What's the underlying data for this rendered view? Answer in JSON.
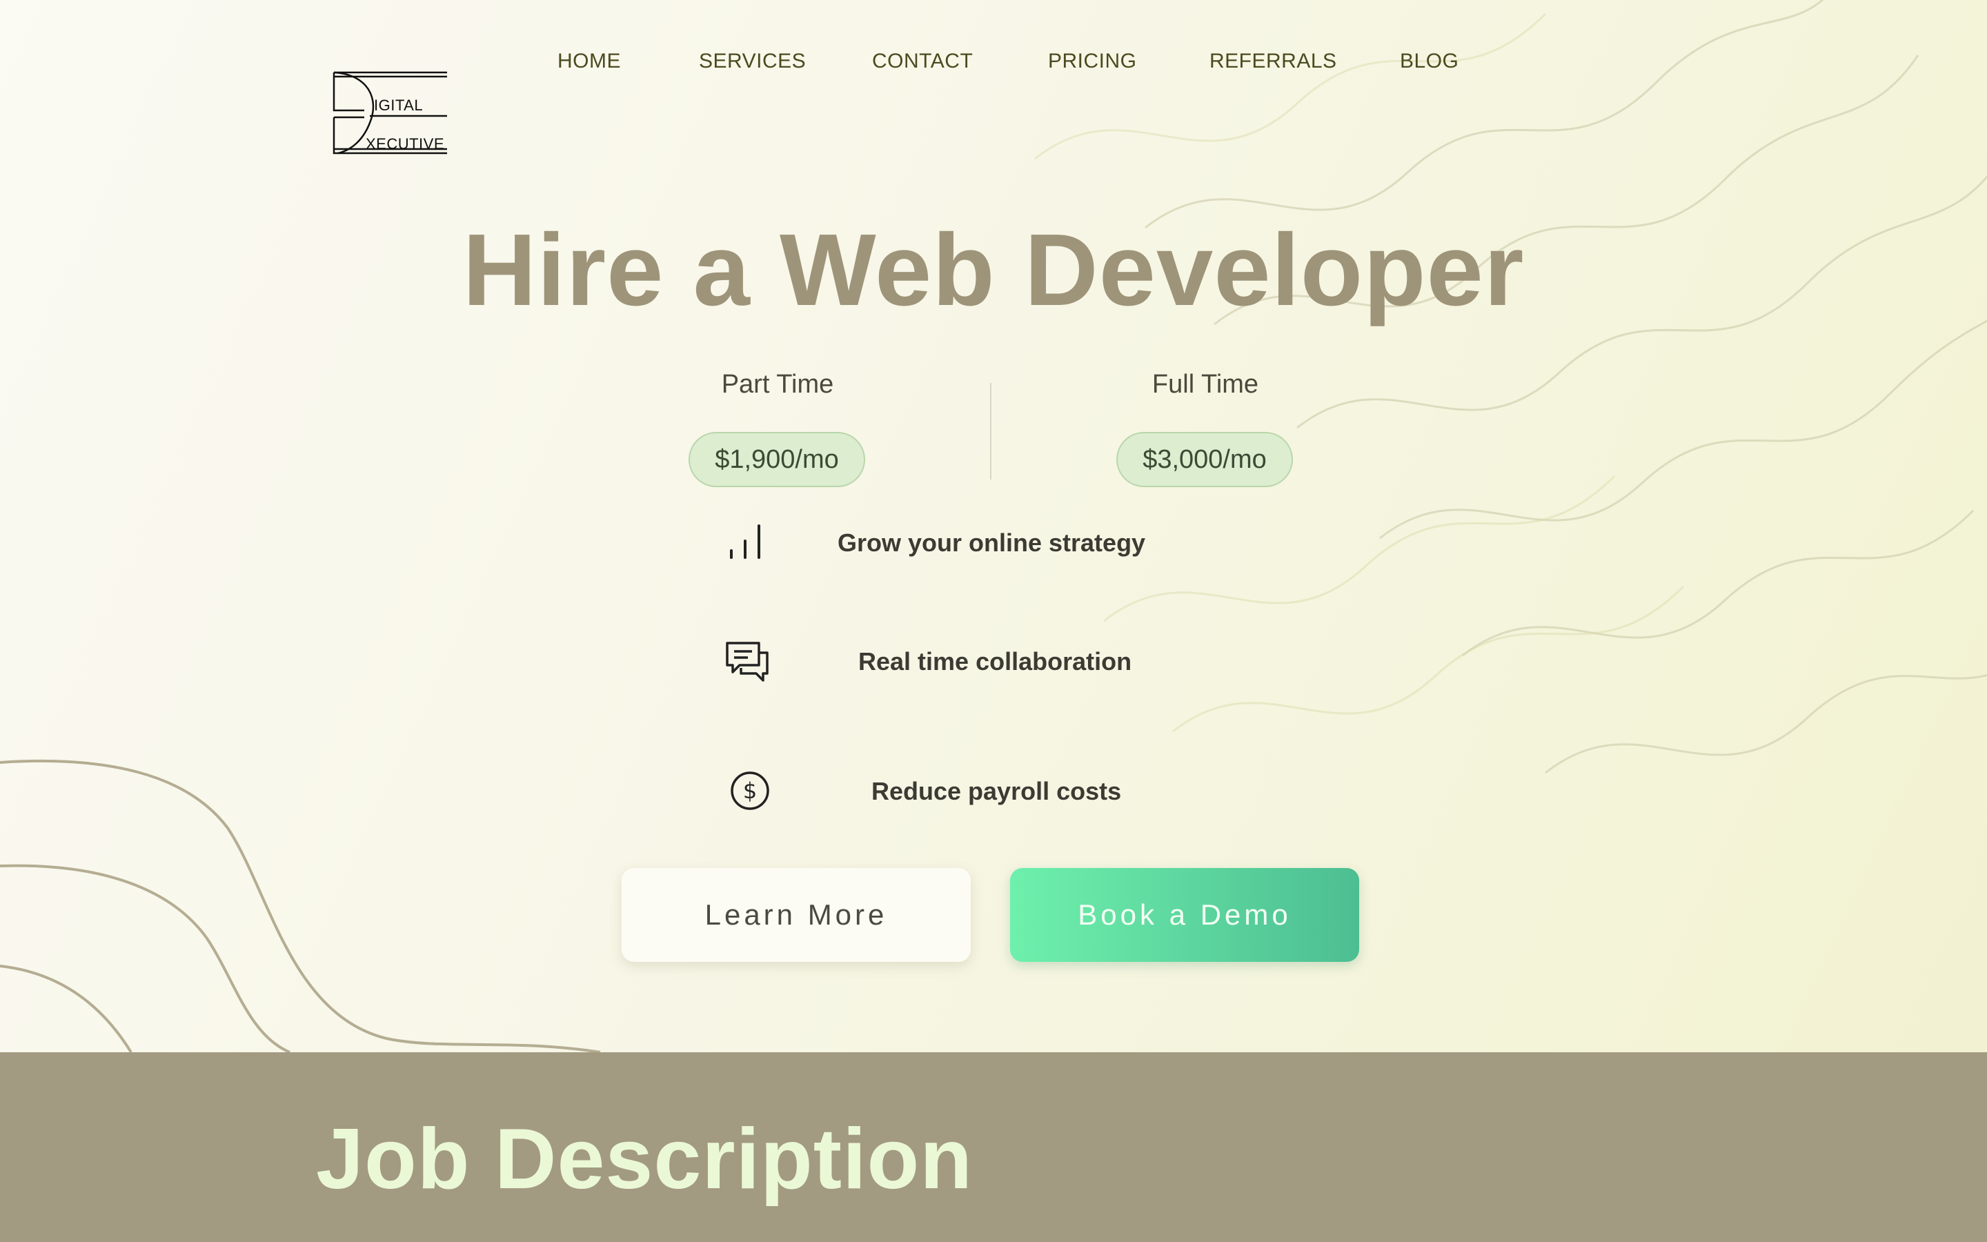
{
  "logo": {
    "word_top": "IGITAL",
    "word_bottom": "XECUTIVE"
  },
  "nav": {
    "items": [
      {
        "label": "HOME"
      },
      {
        "label": "SERVICES"
      },
      {
        "label": "CONTACT"
      },
      {
        "label": "PRICING"
      },
      {
        "label": "REFERRALS"
      },
      {
        "label": "BLOG"
      }
    ]
  },
  "hero": {
    "title": "Hire a Web Developer"
  },
  "pricing": {
    "part_time": {
      "label": "Part Time",
      "price": "$1,900/mo"
    },
    "full_time": {
      "label": "Full Time",
      "price": "$3,000/mo"
    }
  },
  "features": [
    {
      "icon": "bar-chart-icon",
      "text": "Grow your online strategy"
    },
    {
      "icon": "chat-bubbles-icon",
      "text": "Real time collaboration"
    },
    {
      "icon": "dollar-circle-icon",
      "text": "Reduce payroll costs"
    }
  ],
  "buttons": {
    "learn_more": "Learn More",
    "book_demo": "Book a Demo"
  },
  "section": {
    "title": "Job Description"
  },
  "colors": {
    "headline": "#9e9479",
    "nav": "#4c4a1f",
    "pill_bg": "#dcedd0",
    "demo_start": "#6ef0ac",
    "demo_end": "#4dbe92",
    "band": "#a39a82",
    "band_title": "#eaf8d6"
  }
}
